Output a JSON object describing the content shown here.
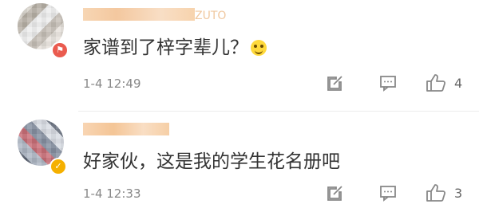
{
  "comments": [
    {
      "nickname_tail": "ZUTO",
      "text": "家谱到了梓字辈儿？",
      "emoji": "laughing-emoji",
      "time": "1-4 12:49",
      "likes": "4",
      "badge": "red-app-badge"
    },
    {
      "text": "好家伙，这是我的学生花名册吧",
      "time": "1-4 12:33",
      "likes": "3",
      "badge": "gold-verified-badge"
    }
  ],
  "icons": {
    "repost": "share-icon",
    "comment": "comment-icon",
    "like": "thumbs-up-icon"
  },
  "colors": {
    "text": "#333333",
    "meta": "#888888",
    "accent": "#f0b47d",
    "verified": "#f5b000",
    "app_badge": "#ea5b4f"
  }
}
